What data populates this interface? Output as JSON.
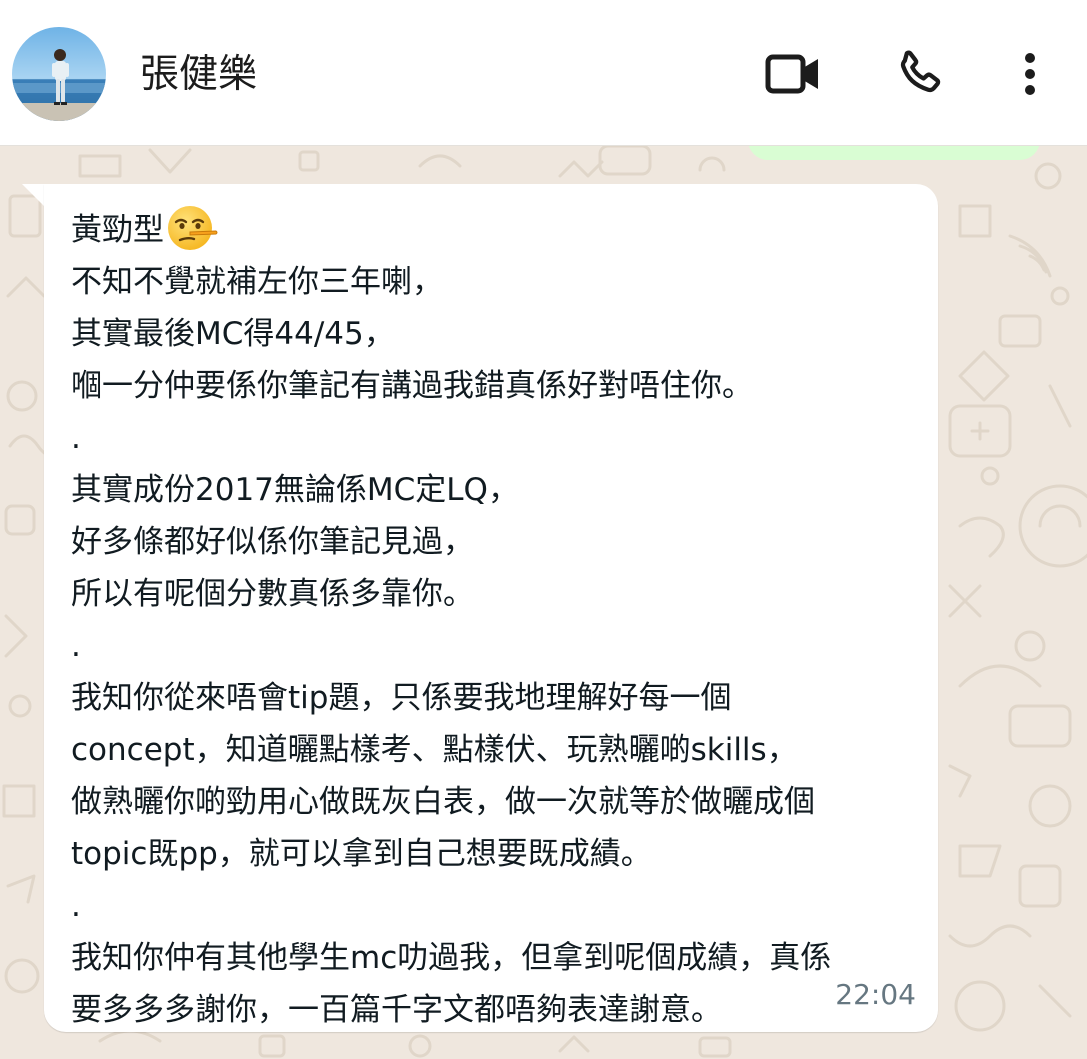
{
  "header": {
    "contact_name": "張健樂",
    "avatar_icon": "contact-photo",
    "video_call_icon": "video-camera-icon",
    "voice_call_icon": "phone-icon",
    "menu_icon": "more-vertical-icon"
  },
  "message": {
    "first_line": "黃勁型",
    "emoji": "lying-face",
    "lines": [
      "不知不覺就補左你三年喇，",
      "其實最後MC得44/45，",
      "嗰一分仲要係你筆記有講過我錯真係好對唔住你。",
      ".",
      "其實成份2017無論係MC定LQ，",
      "好多條都好似係你筆記見過，",
      "所以有呢個分數真係多靠你。",
      ".",
      "我知你從來唔會tip題，只係要我地理解好每一個",
      "concept，知道曬點樣考、點樣伏、玩熟曬啲skills，",
      "做熟曬你啲勁用心做既灰白表，做一次就等於做曬成個",
      "topic既pp，就可以拿到自己想要既成績。",
      ".",
      "我知你仲有其他學生mc叻過我，但拿到呢個成績，真係",
      "要多多多謝你，一百篇千字文都唔夠表達謝意。"
    ],
    "time": "22:04"
  },
  "colors": {
    "header_bg": "#ffffff",
    "chat_bg": "#efe7de",
    "incoming_bubble": "#ffffff",
    "outgoing_bubble": "#d9fdd3",
    "text": "#111b21",
    "timestamp": "#667781",
    "icon": "#1c1c1c"
  }
}
